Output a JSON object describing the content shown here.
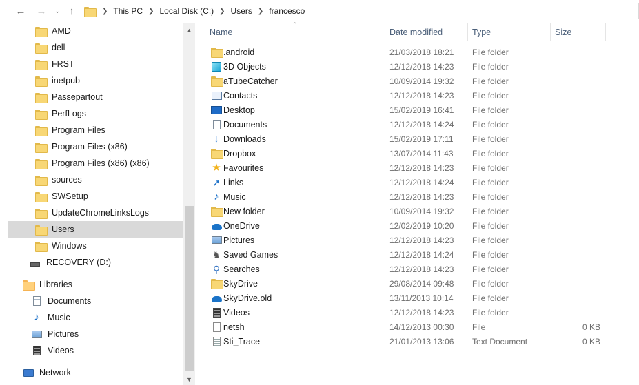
{
  "address": {
    "crumbs": [
      "This PC",
      "Local Disk (C:)",
      "Users",
      "francesco"
    ]
  },
  "columns": {
    "name": "Name",
    "date": "Date modified",
    "type": "Type",
    "size": "Size"
  },
  "nav": [
    {
      "label": "AMD",
      "icon": "folder-icon"
    },
    {
      "label": "dell",
      "icon": "folder-icon"
    },
    {
      "label": "FRST",
      "icon": "folder-icon"
    },
    {
      "label": "inetpub",
      "icon": "folder-icon"
    },
    {
      "label": "Passepartout",
      "icon": "folder-icon"
    },
    {
      "label": "PerfLogs",
      "icon": "folder-icon"
    },
    {
      "label": "Program Files",
      "icon": "folder-icon"
    },
    {
      "label": "Program Files (x86)",
      "icon": "folder-icon"
    },
    {
      "label": "Program Files (x86) (x86)",
      "icon": "folder-icon"
    },
    {
      "label": "sources",
      "icon": "folder-icon"
    },
    {
      "label": "SWSetup",
      "icon": "folder-icon"
    },
    {
      "label": "UpdateChromeLinksLogs",
      "icon": "folder-icon"
    },
    {
      "label": "Users",
      "icon": "folder-icon"
    },
    {
      "label": "Windows",
      "icon": "folder-icon"
    },
    {
      "label": "RECOVERY (D:)",
      "icon": "drive-icon"
    },
    {
      "label": "Libraries",
      "icon": "libraries-icon"
    },
    {
      "label": "Documents",
      "icon": "documents-icon"
    },
    {
      "label": "Music",
      "icon": "music-icon"
    },
    {
      "label": "Pictures",
      "icon": "pictures-icon"
    },
    {
      "label": "Videos",
      "icon": "videos-icon"
    },
    {
      "label": "Network",
      "icon": "network-icon"
    }
  ],
  "files": [
    {
      "name": ".android",
      "date": "21/03/2018 18:21",
      "type": "File folder",
      "size": "",
      "icon": "folder-icon"
    },
    {
      "name": "3D Objects",
      "date": "12/12/2018 14:23",
      "type": "File folder",
      "size": "",
      "icon": "3d-objects-icon"
    },
    {
      "name": "aTubeCatcher",
      "date": "10/09/2014 19:32",
      "type": "File folder",
      "size": "",
      "icon": "folder-icon"
    },
    {
      "name": "Contacts",
      "date": "12/12/2018 14:23",
      "type": "File folder",
      "size": "",
      "icon": "contacts-icon"
    },
    {
      "name": "Desktop",
      "date": "15/02/2019 16:41",
      "type": "File folder",
      "size": "",
      "icon": "desktop-icon"
    },
    {
      "name": "Documents",
      "date": "12/12/2018 14:24",
      "type": "File folder",
      "size": "",
      "icon": "documents-icon"
    },
    {
      "name": "Downloads",
      "date": "15/02/2019 17:11",
      "type": "File folder",
      "size": "",
      "icon": "downloads-icon"
    },
    {
      "name": "Dropbox",
      "date": "13/07/2014 11:43",
      "type": "File folder",
      "size": "",
      "icon": "folder-icon"
    },
    {
      "name": "Favourites",
      "date": "12/12/2018 14:23",
      "type": "File folder",
      "size": "",
      "icon": "favourites-icon"
    },
    {
      "name": "Links",
      "date": "12/12/2018 14:24",
      "type": "File folder",
      "size": "",
      "icon": "links-icon"
    },
    {
      "name": "Music",
      "date": "12/12/2018 14:23",
      "type": "File folder",
      "size": "",
      "icon": "music-icon"
    },
    {
      "name": "New folder",
      "date": "10/09/2014 19:32",
      "type": "File folder",
      "size": "",
      "icon": "folder-icon"
    },
    {
      "name": "OneDrive",
      "date": "12/02/2019 10:20",
      "type": "File folder",
      "size": "",
      "icon": "onedrive-icon"
    },
    {
      "name": "Pictures",
      "date": "12/12/2018 14:23",
      "type": "File folder",
      "size": "",
      "icon": "pictures-icon"
    },
    {
      "name": "Saved Games",
      "date": "12/12/2018 14:24",
      "type": "File folder",
      "size": "",
      "icon": "saved-games-icon"
    },
    {
      "name": "Searches",
      "date": "12/12/2018 14:23",
      "type": "File folder",
      "size": "",
      "icon": "searches-icon"
    },
    {
      "name": "SkyDrive",
      "date": "29/08/2014 09:48",
      "type": "File folder",
      "size": "",
      "icon": "folder-icon"
    },
    {
      "name": "SkyDrive.old",
      "date": "13/11/2013 10:14",
      "type": "File folder",
      "size": "",
      "icon": "onedrive-icon"
    },
    {
      "name": "Videos",
      "date": "12/12/2018 14:23",
      "type": "File folder",
      "size": "",
      "icon": "videos-icon"
    },
    {
      "name": "netsh",
      "date": "14/12/2013 00:30",
      "type": "File",
      "size": "0 KB",
      "icon": "file-icon"
    },
    {
      "name": "Sti_Trace",
      "date": "21/01/2013 13:06",
      "type": "Text Document",
      "size": "0 KB",
      "icon": "text-document-icon"
    }
  ]
}
